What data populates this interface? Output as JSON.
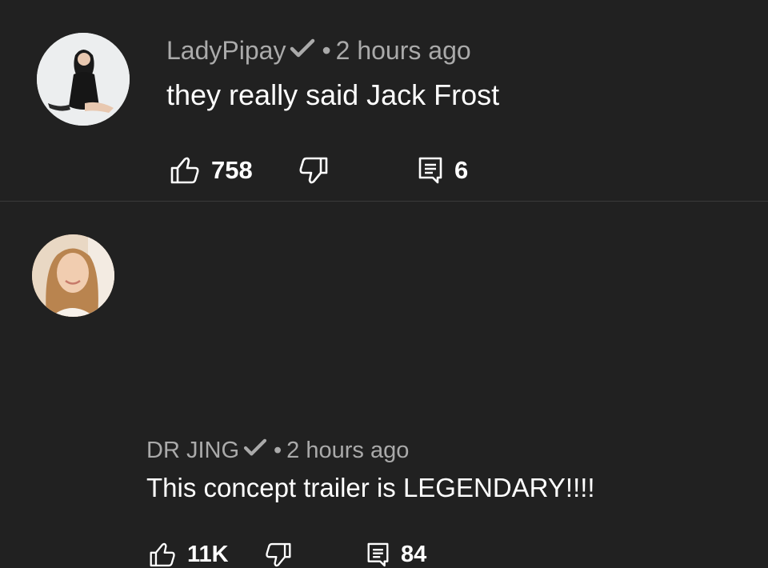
{
  "comments": [
    {
      "author": "LadyPipay",
      "verified": true,
      "separator": "•",
      "time": "2 hours ago",
      "text": "they really said Jack Frost",
      "likes": "758",
      "replies": "6",
      "icons": [
        "verified-check-icon",
        "thumbs-up-icon",
        "thumbs-down-icon",
        "reply-icon"
      ]
    },
    {
      "author": "DR JING",
      "verified": true,
      "separator": "•",
      "time": "2 hours ago",
      "text": "This concept trailer is LEGENDARY!!!!",
      "likes": "11K",
      "replies": "84",
      "icons": [
        "verified-check-icon",
        "thumbs-up-icon",
        "thumbs-down-icon",
        "reply-icon"
      ]
    }
  ],
  "colors": {
    "background": "#212121",
    "meta_text": "#aaaaaa",
    "body_text": "#ffffff",
    "divider": "#3a3a3a"
  }
}
